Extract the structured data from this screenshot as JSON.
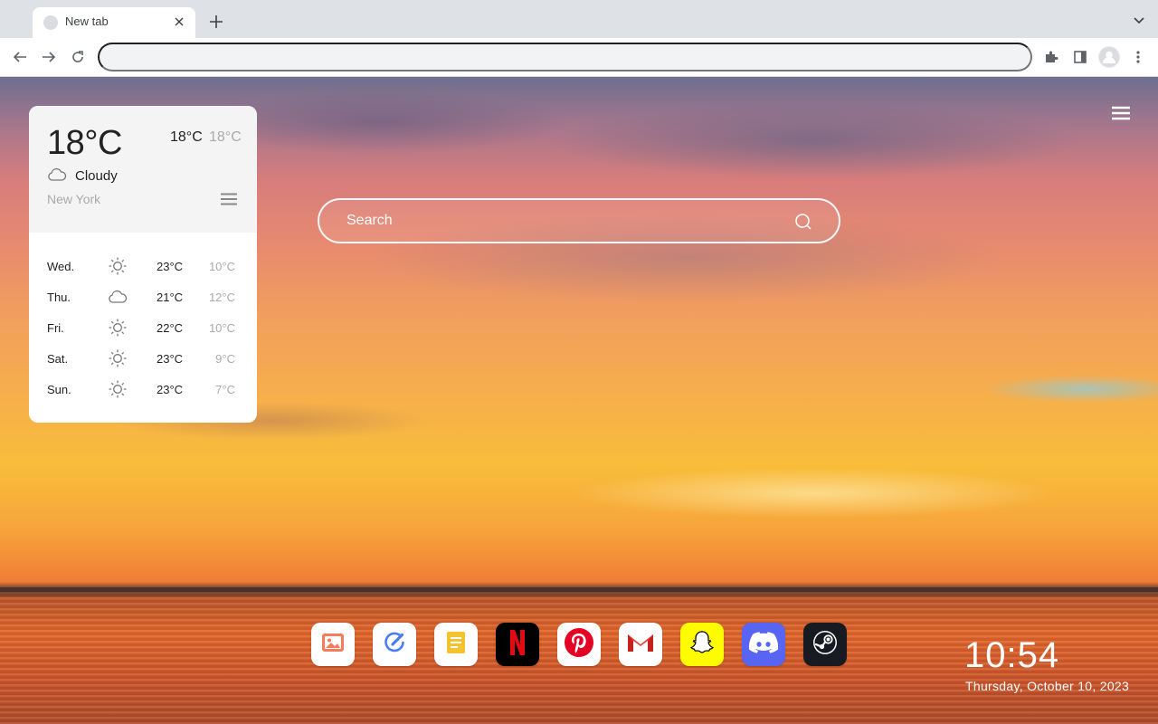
{
  "browser": {
    "tab": {
      "title": "New tab"
    },
    "omnibox": {
      "value": ""
    }
  },
  "weather": {
    "current_temp": "18°C",
    "high": "18°C",
    "low": "18°C",
    "condition": "Cloudy",
    "city": "New York",
    "forecast": [
      {
        "day": "Wed.",
        "icon": "sun-icon",
        "high": "23°C",
        "low": "10°C"
      },
      {
        "day": "Thu.",
        "icon": "cloud-icon",
        "high": "21°C",
        "low": "12°C"
      },
      {
        "day": "Fri.",
        "icon": "sun-icon",
        "high": "22°C",
        "low": "10°C"
      },
      {
        "day": "Sat.",
        "icon": "sun-icon",
        "high": "23°C",
        "low": "9°C"
      },
      {
        "day": "Sun.",
        "icon": "sun-icon",
        "high": "23°C",
        "low": "7°C"
      }
    ]
  },
  "search": {
    "placeholder": "Search"
  },
  "dock": {
    "apps": [
      {
        "name": "photos",
        "icon": "photo-icon",
        "bg": "#ffffff"
      },
      {
        "name": "tasks",
        "icon": "check-pen-icon",
        "bg": "#ffffff"
      },
      {
        "name": "notes",
        "icon": "note-icon",
        "bg": "#ffffff"
      },
      {
        "name": "netflix",
        "icon": "netflix-icon",
        "bg": "#000000"
      },
      {
        "name": "pinterest",
        "icon": "pinterest-icon",
        "bg": "#ffffff"
      },
      {
        "name": "gmail",
        "icon": "gmail-icon",
        "bg": "#ffffff"
      },
      {
        "name": "snapchat",
        "icon": "snapchat-icon",
        "bg": "#fffc00"
      },
      {
        "name": "discord",
        "icon": "discord-icon",
        "bg": "#5865f2"
      },
      {
        "name": "steam",
        "icon": "steam-icon",
        "bg": "#171a21"
      }
    ]
  },
  "clock": {
    "time": "10:54",
    "date": "Thursday, October 10, 2023"
  },
  "colors": {
    "accent_netflix": "#e50914",
    "accent_pinterest": "#e60023",
    "accent_gmail": "#ea4335"
  }
}
